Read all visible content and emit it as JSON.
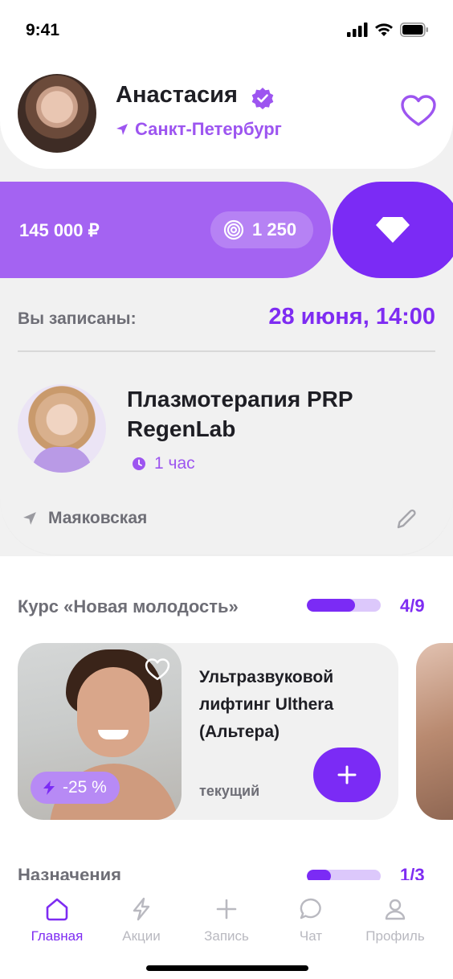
{
  "status_bar": {
    "time": "9:41"
  },
  "profile": {
    "name": "Анастасия",
    "city": "Санкт-Петербург"
  },
  "balance": {
    "amount": "145 000 ₽",
    "coins": "1 250"
  },
  "appointment": {
    "label": "Вы записаны:",
    "date": "28 июня, 14:00",
    "service_title": "Плазмотерапия PRP RegenLab",
    "duration": "1 час",
    "location": "Маяковская"
  },
  "course": {
    "title": "Курс «Новая молодость»",
    "progress_text": "4/9",
    "progress_fraction": 0.65,
    "card": {
      "name": "Ультразвуковой лифтинг Ulthera (Альтера)",
      "discount": "-25 %",
      "status": "текущий"
    }
  },
  "section2": {
    "title": "Назначения",
    "progress_text": "1/3",
    "progress_fraction": 0.33
  },
  "tabs": [
    {
      "label": "Главная",
      "icon": "home-icon",
      "active": true
    },
    {
      "label": "Акции",
      "icon": "lightning-icon",
      "active": false
    },
    {
      "label": "Запись",
      "icon": "plus-icon",
      "active": false
    },
    {
      "label": "Чат",
      "icon": "chat-icon",
      "active": false
    },
    {
      "label": "Профиль",
      "icon": "profile-icon",
      "active": false
    }
  ],
  "colors": {
    "accent": "#7b2bf5",
    "accent_light": "#a463f2",
    "text_muted": "#6e6e76",
    "background": "#f1f1f1"
  }
}
